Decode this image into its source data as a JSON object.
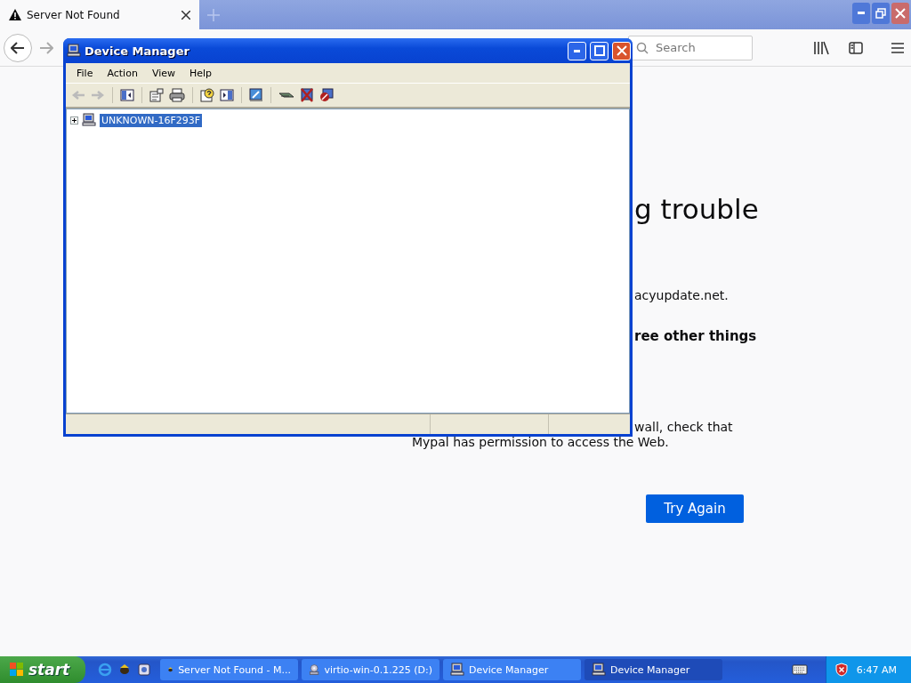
{
  "browser": {
    "tab": {
      "title": "Server Not Found",
      "selected": true
    },
    "search": {
      "placeholder": "Search"
    },
    "page": {
      "heading": "g trouble",
      "lines": [
        {
          "kind": "plain",
          "text": "acyupdate.net."
        },
        {
          "kind": "bold",
          "text": "ree other things"
        },
        {
          "kind": "plain",
          "text": "wall, check that"
        },
        {
          "kind": "wide",
          "text": "Mypal has permission to access the Web."
        }
      ],
      "button": "Try Again"
    }
  },
  "device_manager": {
    "title": "Device Manager",
    "menu": [
      "File",
      "Action",
      "View",
      "Help"
    ],
    "tree": [
      {
        "label": "UNKNOWN-16F293F",
        "selected": true,
        "expanded": false
      }
    ]
  },
  "taskbar": {
    "start": "start",
    "tasks": [
      {
        "label": "Server Not Found - M...",
        "kind": "browser",
        "selected": false
      },
      {
        "label": "virtio-win-0.1.225 (D:)",
        "kind": "disc",
        "selected": false
      },
      {
        "label": "Device Manager",
        "kind": "computer",
        "selected": false
      },
      {
        "label": "Device Manager",
        "kind": "computer",
        "selected": true
      }
    ],
    "clock": "6:47 AM"
  }
}
